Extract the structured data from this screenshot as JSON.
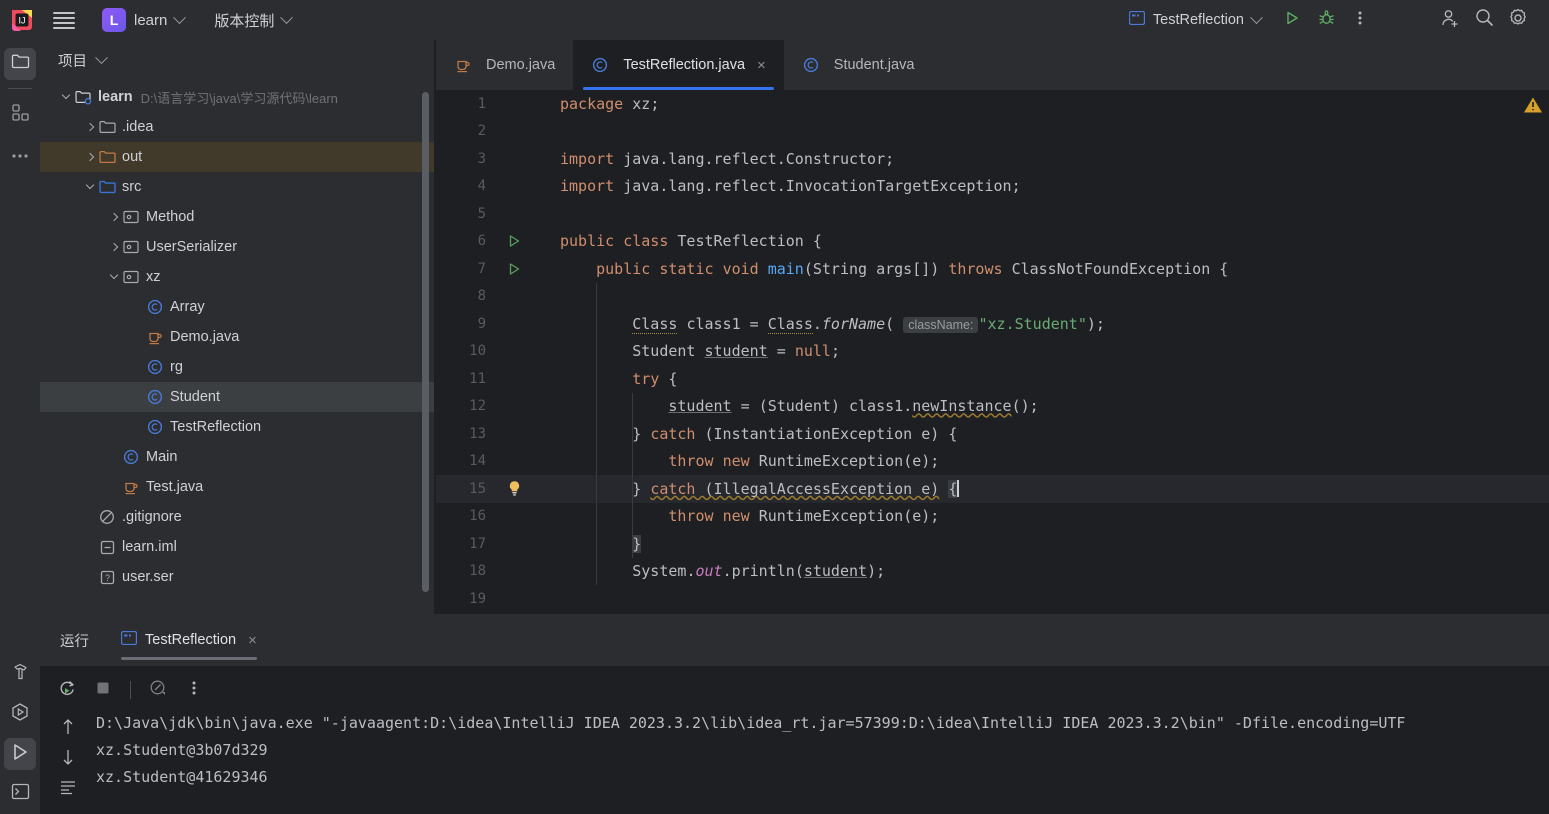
{
  "titlebar": {
    "logo_icon": "intellij-idea-logo",
    "menu_icon": "hamburger-menu-icon",
    "project_badge": "L",
    "project_name": "learn",
    "vcs_label": "版本控制",
    "run_config_name": "TestReflection",
    "run_icon": "run-triangle-icon",
    "debug_icon": "debug-bug-icon",
    "more_icon": "more-vertical-icon",
    "add_user_icon": "add-user-icon",
    "search_icon": "search-icon",
    "settings_icon": "gear-icon"
  },
  "activity_bar": {
    "items": [
      {
        "name": "project-tool-icon",
        "icon": "folder-icon",
        "active": true
      },
      {
        "name": "structure-tool-icon",
        "icon": "structure-squares-icon",
        "active": false
      },
      {
        "name": "more-tool-windows-icon",
        "icon": "ellipsis-icon",
        "active": false
      }
    ],
    "bottom_items": [
      {
        "name": "build-tool-icon",
        "icon": "hammer-icon",
        "active": false
      },
      {
        "name": "services-tool-icon",
        "icon": "hexagon-play-icon",
        "active": false
      },
      {
        "name": "run-tool-icon",
        "icon": "play-triangle-icon",
        "active": true
      },
      {
        "name": "terminal-tool-icon",
        "icon": "terminal-icon",
        "active": false
      }
    ]
  },
  "project_panel": {
    "title": "项目",
    "chevron_icon": "chevron-down-icon",
    "tree": [
      {
        "label": "learn",
        "hint": "D:\\语言学习\\java\\学习源代码\\learn",
        "indent": 0,
        "arrow": "down",
        "icon": "module-folder-icon",
        "bold": true,
        "state": "normal"
      },
      {
        "label": ".idea",
        "hint": "",
        "indent": 1,
        "arrow": "right",
        "icon": "folder-gray-icon",
        "bold": false,
        "state": "normal"
      },
      {
        "label": "out",
        "hint": "",
        "indent": 1,
        "arrow": "right",
        "icon": "folder-orange-icon",
        "bold": false,
        "state": "highlight"
      },
      {
        "label": "src",
        "hint": "",
        "indent": 1,
        "arrow": "down",
        "icon": "folder-blue-icon",
        "bold": false,
        "state": "normal"
      },
      {
        "label": "Method",
        "hint": "",
        "indent": 2,
        "arrow": "right",
        "icon": "package-icon",
        "bold": false,
        "state": "normal"
      },
      {
        "label": "UserSerializer",
        "hint": "",
        "indent": 2,
        "arrow": "right",
        "icon": "package-icon",
        "bold": false,
        "state": "normal"
      },
      {
        "label": "xz",
        "hint": "",
        "indent": 2,
        "arrow": "down",
        "icon": "package-icon",
        "bold": false,
        "state": "normal"
      },
      {
        "label": "Array",
        "hint": "",
        "indent": 3,
        "arrow": "none",
        "icon": "java-class-icon",
        "bold": false,
        "state": "normal"
      },
      {
        "label": "Demo.java",
        "hint": "",
        "indent": 3,
        "arrow": "none",
        "icon": "java-file-icon",
        "bold": false,
        "state": "normal"
      },
      {
        "label": "rg",
        "hint": "",
        "indent": 3,
        "arrow": "none",
        "icon": "java-class-icon",
        "bold": false,
        "state": "normal"
      },
      {
        "label": "Student",
        "hint": "",
        "indent": 3,
        "arrow": "none",
        "icon": "java-class-icon",
        "bold": false,
        "state": "selected"
      },
      {
        "label": "TestReflection",
        "hint": "",
        "indent": 3,
        "arrow": "none",
        "icon": "java-class-icon",
        "bold": false,
        "state": "normal"
      },
      {
        "label": "Main",
        "hint": "",
        "indent": 2,
        "arrow": "none",
        "icon": "java-class-icon",
        "bold": false,
        "state": "normal"
      },
      {
        "label": "Test.java",
        "hint": "",
        "indent": 2,
        "arrow": "none",
        "icon": "java-file-icon",
        "bold": false,
        "state": "normal"
      },
      {
        "label": ".gitignore",
        "hint": "",
        "indent": 1,
        "arrow": "none",
        "icon": "gitignore-icon",
        "bold": false,
        "state": "normal"
      },
      {
        "label": "learn.iml",
        "hint": "",
        "indent": 1,
        "arrow": "none",
        "icon": "iml-file-icon",
        "bold": false,
        "state": "normal"
      },
      {
        "label": "user.ser",
        "hint": "",
        "indent": 1,
        "arrow": "none",
        "icon": "unknown-file-icon",
        "bold": false,
        "state": "normal"
      }
    ]
  },
  "editor": {
    "tabs": [
      {
        "label": "Demo.java",
        "icon": "java-file-icon",
        "active": false,
        "closable": false
      },
      {
        "label": "TestReflection.java",
        "icon": "java-class-icon",
        "active": true,
        "closable": true
      },
      {
        "label": "Student.java",
        "icon": "java-class-icon",
        "active": false,
        "closable": false
      }
    ],
    "close_glyph": "×",
    "warning_icon": "warning-triangle-icon",
    "current_line": 15,
    "lines": [
      {
        "n": 1,
        "gutter": "",
        "text": "package xz;"
      },
      {
        "n": 2,
        "gutter": "",
        "text": ""
      },
      {
        "n": 3,
        "gutter": "",
        "text": "import java.lang.reflect.Constructor;"
      },
      {
        "n": 4,
        "gutter": "",
        "text": "import java.lang.reflect.InvocationTargetException;"
      },
      {
        "n": 5,
        "gutter": "",
        "text": ""
      },
      {
        "n": 6,
        "gutter": "run-gutter-icon",
        "text": "public class TestReflection {"
      },
      {
        "n": 7,
        "gutter": "run-gutter-icon",
        "text": "    public static void main(String args[]) throws ClassNotFoundException {"
      },
      {
        "n": 8,
        "gutter": "",
        "text": ""
      },
      {
        "n": 9,
        "gutter": "",
        "text": "        Class class1 = Class.forName( className: \"xz.Student\");"
      },
      {
        "n": 10,
        "gutter": "",
        "text": "        Student student = null;"
      },
      {
        "n": 11,
        "gutter": "",
        "text": "        try {"
      },
      {
        "n": 12,
        "gutter": "",
        "text": "            student = (Student) class1.newInstance();"
      },
      {
        "n": 13,
        "gutter": "",
        "text": "        } catch (InstantiationException e) {"
      },
      {
        "n": 14,
        "gutter": "",
        "text": "            throw new RuntimeException(e);"
      },
      {
        "n": 15,
        "gutter": "lightbulb-icon",
        "text": "        } catch (IllegalAccessException e) {"
      },
      {
        "n": 16,
        "gutter": "",
        "text": "            throw new RuntimeException(e);"
      },
      {
        "n": 17,
        "gutter": "",
        "text": "        }"
      },
      {
        "n": 18,
        "gutter": "",
        "text": "        System.out.println(student);"
      },
      {
        "n": 19,
        "gutter": "",
        "text": ""
      }
    ],
    "param_hint_9": "className:"
  },
  "run_panel": {
    "title": "运行",
    "tab_label": "TestReflection",
    "tab_icon": "run-config-icon",
    "close_glyph": "×",
    "toolbar": [
      {
        "name": "rerun-button",
        "icon": "rerun-circular-arrow-icon"
      },
      {
        "name": "stop-button",
        "icon": "stop-square-icon"
      },
      {
        "name": "profiler-button",
        "icon": "gauge-icon"
      },
      {
        "name": "more-options-button",
        "icon": "more-vertical-icon"
      }
    ],
    "scroll_up_icon": "arrow-up-icon",
    "scroll_down_icon": "arrow-down-icon",
    "soft_wrap_icon": "soft-wrap-lines-icon",
    "console_lines": [
      "D:\\Java\\jdk\\bin\\java.exe \"-javaagent:D:\\idea\\IntelliJ IDEA 2023.3.2\\lib\\idea_rt.jar=57399:D:\\idea\\IntelliJ IDEA 2023.3.2\\bin\" -Dfile.encoding=UTF",
      "xz.Student@3b07d329",
      "xz.Student@41629346"
    ]
  },
  "colors": {
    "bg_editor": "#1e1f22",
    "bg_panel": "#2b2d30",
    "accent_blue": "#3574f0",
    "keyword_orange": "#cf8e6d",
    "string_green": "#6aab73",
    "method_blue": "#56a8f5",
    "static_purple": "#c77dbb",
    "text": "#bcbec4",
    "highlight_row": "#413a2a",
    "selected_row": "#3c3f41"
  }
}
